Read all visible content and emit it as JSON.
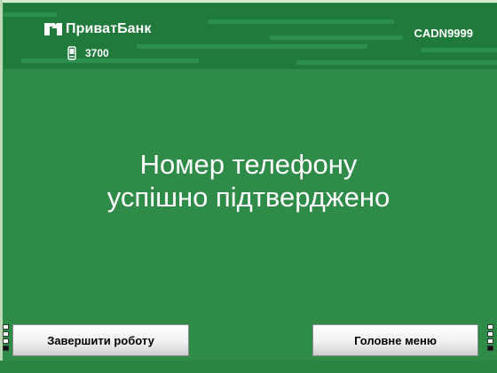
{
  "header": {
    "brand_name": "ПриватБанк",
    "phone_number": "3700",
    "terminal_id": "CADN9999"
  },
  "message": {
    "line1": "Номер телефону",
    "line2": "успішно підтверджено"
  },
  "buttons": {
    "left_label": "Завершити роботу",
    "right_label": "Головне меню"
  },
  "colors": {
    "background": "#2e8b48",
    "header": "#1f7a3c",
    "text": "#ffffff"
  },
  "icons": {
    "logo": "privatbank-logo-icon",
    "phone": "mobile-phone-icon"
  }
}
